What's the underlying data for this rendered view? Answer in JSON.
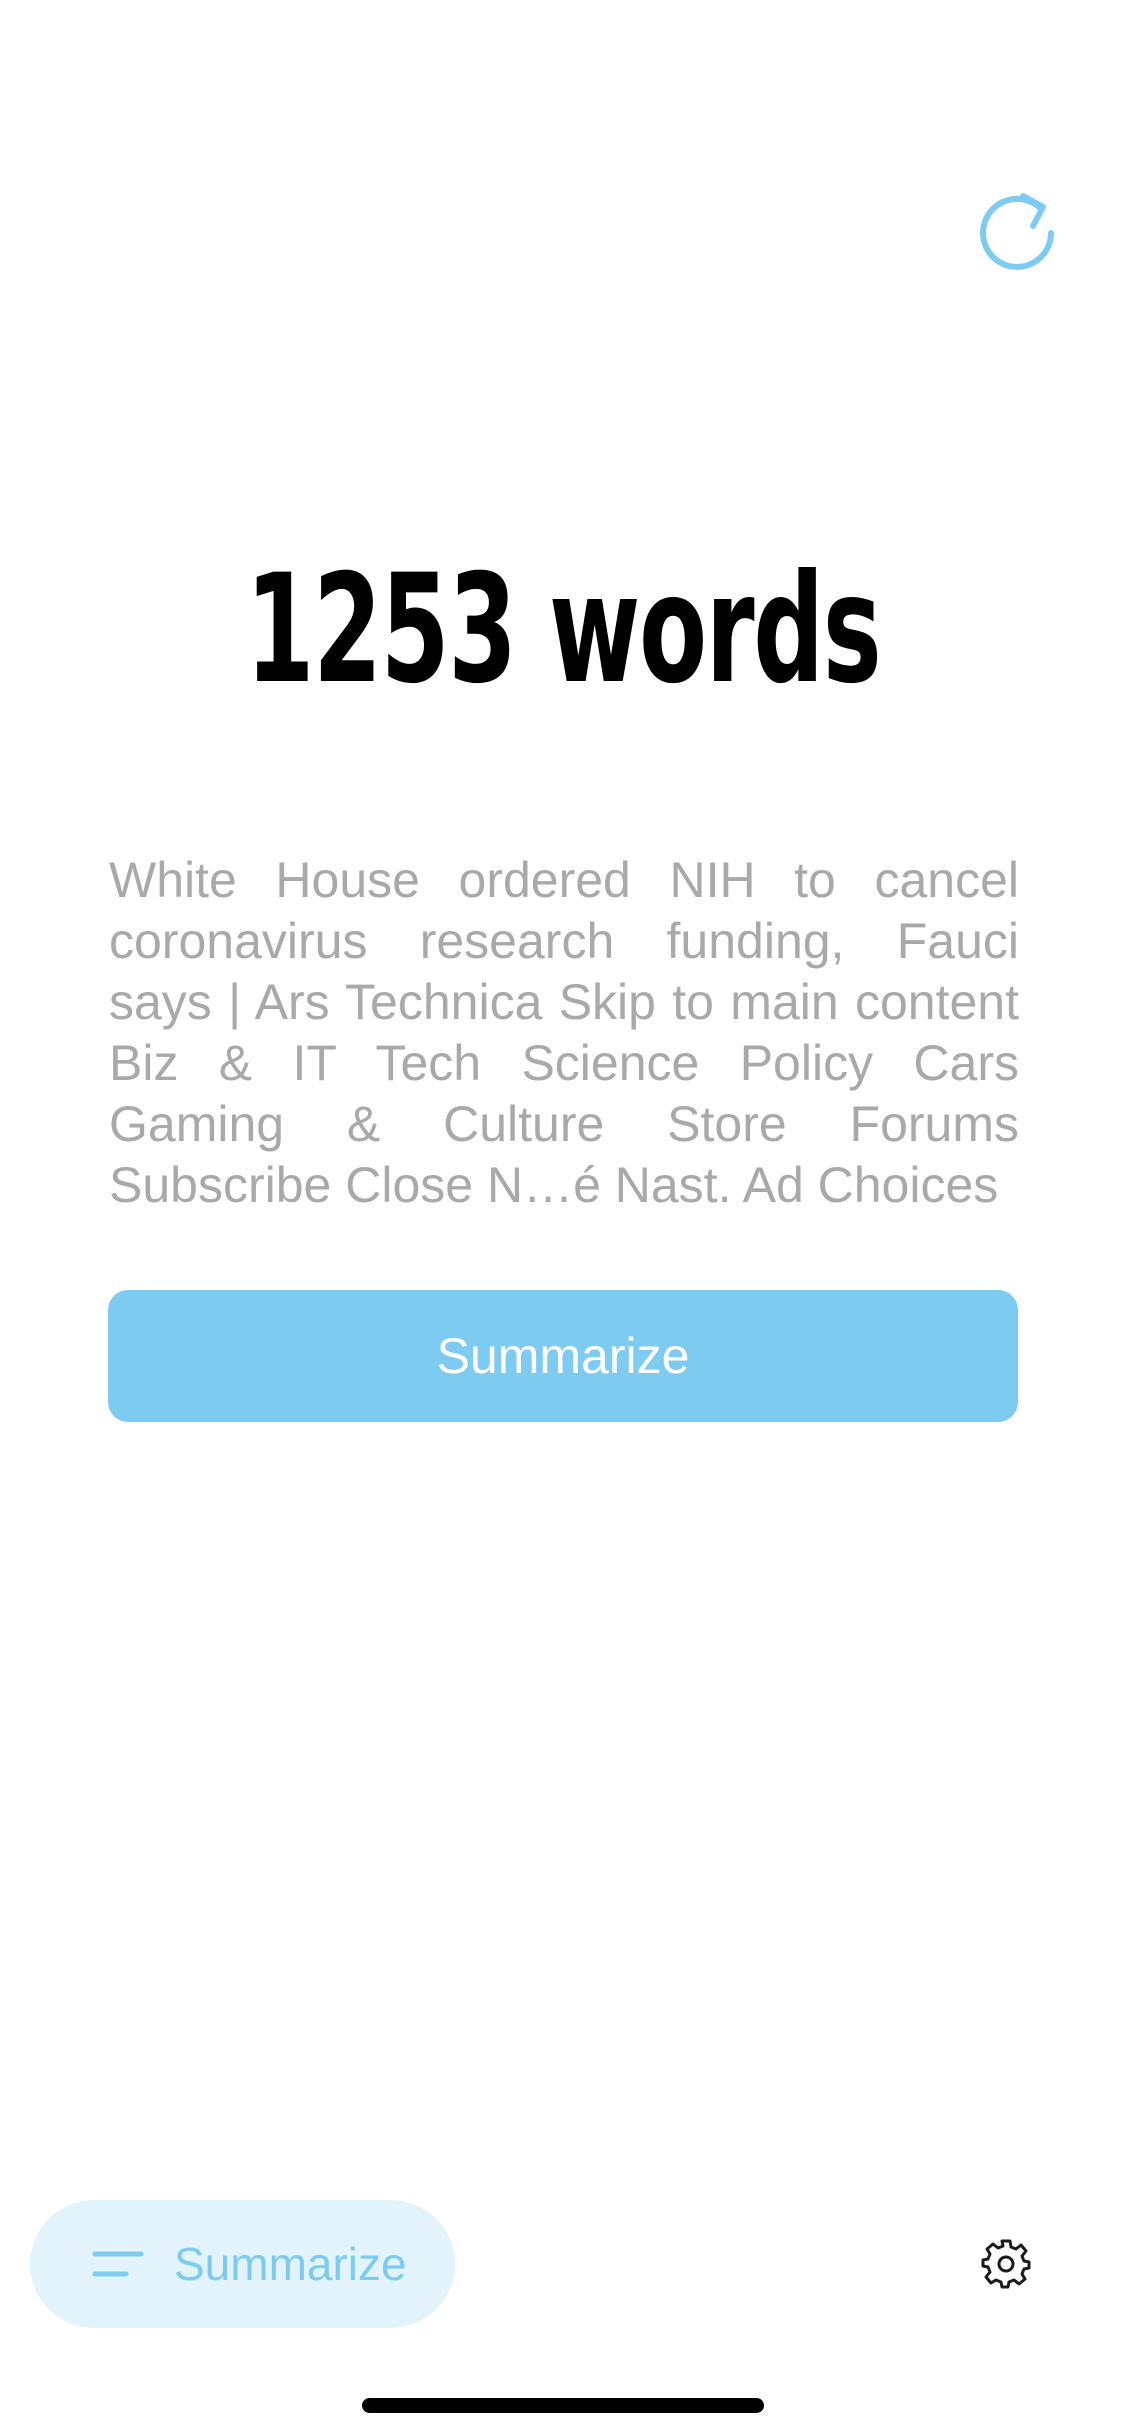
{
  "header": {
    "refresh_icon": "refresh-icon"
  },
  "main": {
    "word_count_label": "1253 words",
    "excerpt": "White House ordered NIH to cancel coronavirus research funding, Fauci says | Ars Technica Skip to main content Biz & IT Tech Science Policy Cars Gaming & Culture Store Forums Subscribe Close N…é Nast. Ad Choices",
    "summarize_button_label": "Summarize"
  },
  "bottom_bar": {
    "tab_label": "Summarize",
    "tab_icon": "menu-lines-icon",
    "settings_icon": "gear-icon"
  },
  "colors": {
    "accent": "#7dcbf0",
    "accent_light": "#e3f3fb",
    "text_primary": "#000000",
    "text_secondary": "#a9a9ab",
    "background": "#ffffff"
  }
}
